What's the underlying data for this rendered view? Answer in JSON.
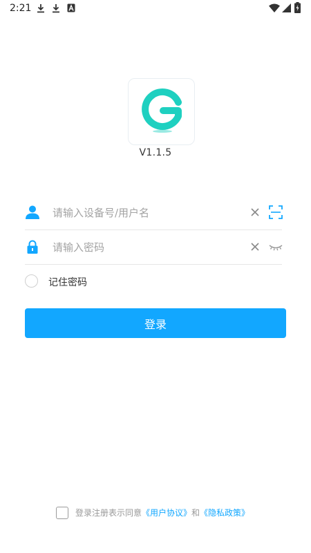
{
  "status_bar": {
    "time": "2:21"
  },
  "app": {
    "version": "V1.1.5",
    "logo_letter": "G"
  },
  "login_form": {
    "username_placeholder": "请输入设备号/用户名",
    "password_placeholder": "请输入密码",
    "remember_label": "记住密码",
    "login_button": "登录"
  },
  "agreement": {
    "prefix": "登录注册表示同意",
    "user_agreement": "《用户协议》",
    "conjunction": "和",
    "privacy_policy": "《隐私政策》"
  },
  "colors": {
    "accent": "#12a7ff",
    "logo_teal": "#1fd0c0",
    "placeholder": "#a3a3a3"
  },
  "icons": {
    "status": [
      "download-icon",
      "download-icon",
      "a-icon",
      "wifi-icon",
      "signal-icon",
      "battery-icon"
    ],
    "fields": [
      "user-icon",
      "lock-icon",
      "clear-icon",
      "scan-icon",
      "eye-closed-icon"
    ]
  }
}
